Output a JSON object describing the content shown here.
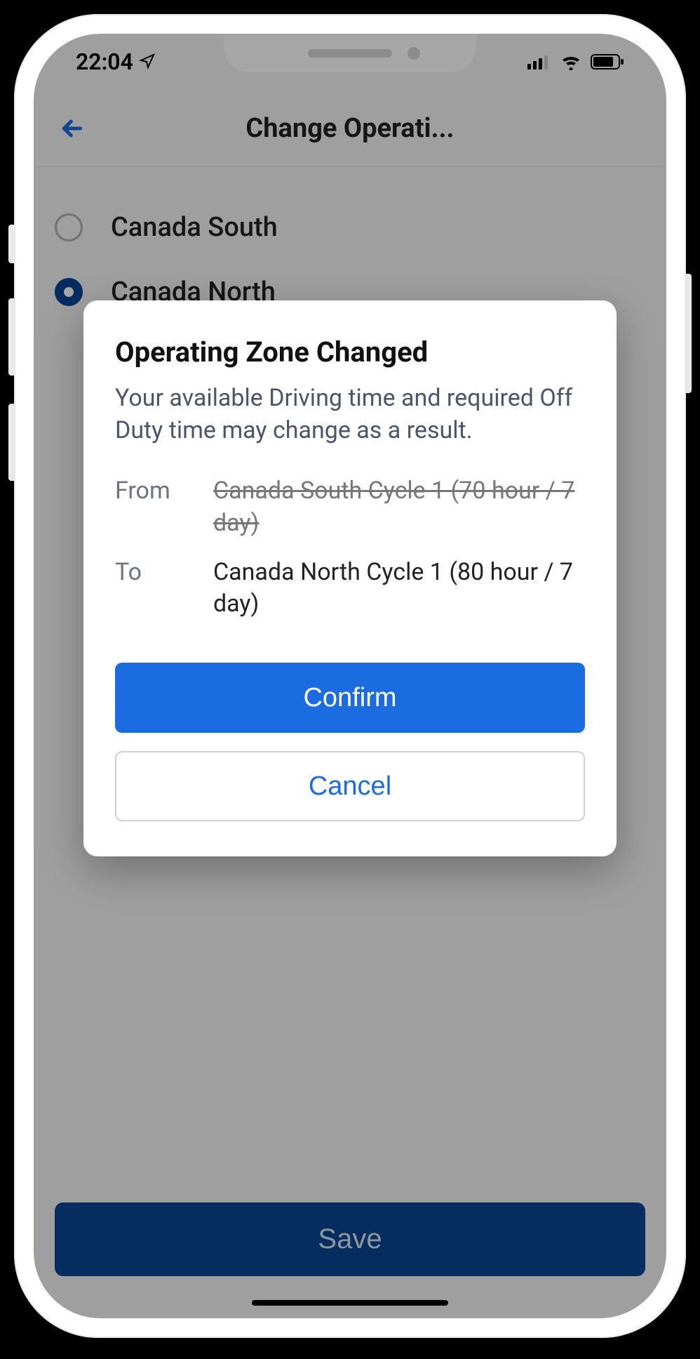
{
  "status": {
    "time": "22:04"
  },
  "header": {
    "title": "Change Operati..."
  },
  "options": [
    {
      "label": "Canada South",
      "selected": false
    },
    {
      "label": "Canada North",
      "selected": true
    }
  ],
  "save_label": "Save",
  "dialog": {
    "title": "Operating Zone Changed",
    "body": "Your available Driving time and required Off Duty time may change as a result.",
    "from_label": "From",
    "from_value": "Canada South Cycle 1 (70 hour / 7 day)",
    "to_label": "To",
    "to_value": "Canada North Cycle 1 (80 hour / 7 day)",
    "confirm_label": "Confirm",
    "cancel_label": "Cancel"
  }
}
